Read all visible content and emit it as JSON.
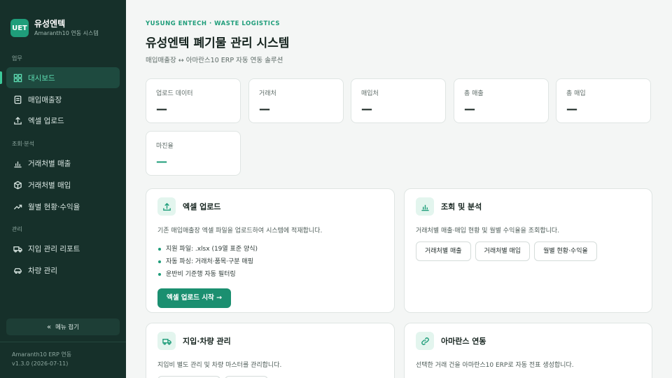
{
  "brand": {
    "logo": "UET",
    "name": "유성엔텍",
    "subtitle": "Amaranth10 연동 시스템"
  },
  "sidebar": {
    "sections": [
      {
        "label": "업무"
      },
      {
        "label": "조회·분석"
      },
      {
        "label": "관리"
      }
    ],
    "items": [
      {
        "label": "대시보드",
        "icon": "dashboard-icon",
        "active": true
      },
      {
        "label": "매입매출장",
        "icon": "ledger-icon"
      },
      {
        "label": "엑셀 업로드",
        "icon": "upload-icon"
      },
      {
        "label": "거래처별 매출",
        "icon": "bar-chart-icon"
      },
      {
        "label": "거래처별 매입",
        "icon": "box-icon"
      },
      {
        "label": "월별 현황·수익율",
        "icon": "trend-icon"
      },
      {
        "label": "지입 관리 리포트",
        "icon": "truck-icon"
      },
      {
        "label": "차량 관리",
        "icon": "car-icon"
      }
    ],
    "collapse_label": "메뉴 접기",
    "footer": {
      "app": "Amaranth10 ERP 연동",
      "version": "v1.3.0 (2026-07-11)"
    }
  },
  "header": {
    "eyebrow": "YUSUNG ENTECH · WASTE LOGISTICS",
    "title": "유성엔텍 폐기물 관리 시스템",
    "subtitle": "매입매출장 ↔ 아마란스10 ERP 자동 연동 솔루션"
  },
  "stats": [
    {
      "label": "업로드 데이터",
      "value": "—"
    },
    {
      "label": "거래처",
      "value": "—"
    },
    {
      "label": "매입처",
      "value": "—"
    },
    {
      "label": "총 매출",
      "value": "—"
    },
    {
      "label": "총 매입",
      "value": "—"
    },
    {
      "label": "마진율",
      "value": "—"
    }
  ],
  "cards": {
    "upload": {
      "title": "엑셀 업로드",
      "icon": "upload-icon",
      "desc": "기존 매입매출장 엑셀 파일을 업로드하여 시스템에 적재합니다.",
      "bullets": [
        "지원 파일: .xlsx (19열 표준 양식)",
        "자동 파싱: 거래처·품목·구분 매핑",
        "운반비 기준행 자동 필터링"
      ],
      "button": "엑셀 업로드 시작 →"
    },
    "analysis": {
      "title": "조회 및 분석",
      "icon": "bar-chart-icon",
      "desc": "거래처별 매출·매입 현황 및 월별 수익율을 조회합니다.",
      "buttons": [
        "거래처별 매출",
        "거래처별 매입",
        "월별 현황·수익율"
      ]
    },
    "vehicle": {
      "title": "지입·차량 관리",
      "icon": "truck-icon",
      "desc": "지입비 별도 관리 및 차량 마스터를 관리합니다."
    },
    "amaranth": {
      "title": "아마란스 연동",
      "icon": "link-icon",
      "desc": "선택한 거래 건을 아마란스10 ERP로 자동 전표 생성합니다."
    }
  },
  "colors": {
    "accent": "#1f9d7a",
    "sidebar": "#16302a",
    "active": "#5fe0b5"
  }
}
